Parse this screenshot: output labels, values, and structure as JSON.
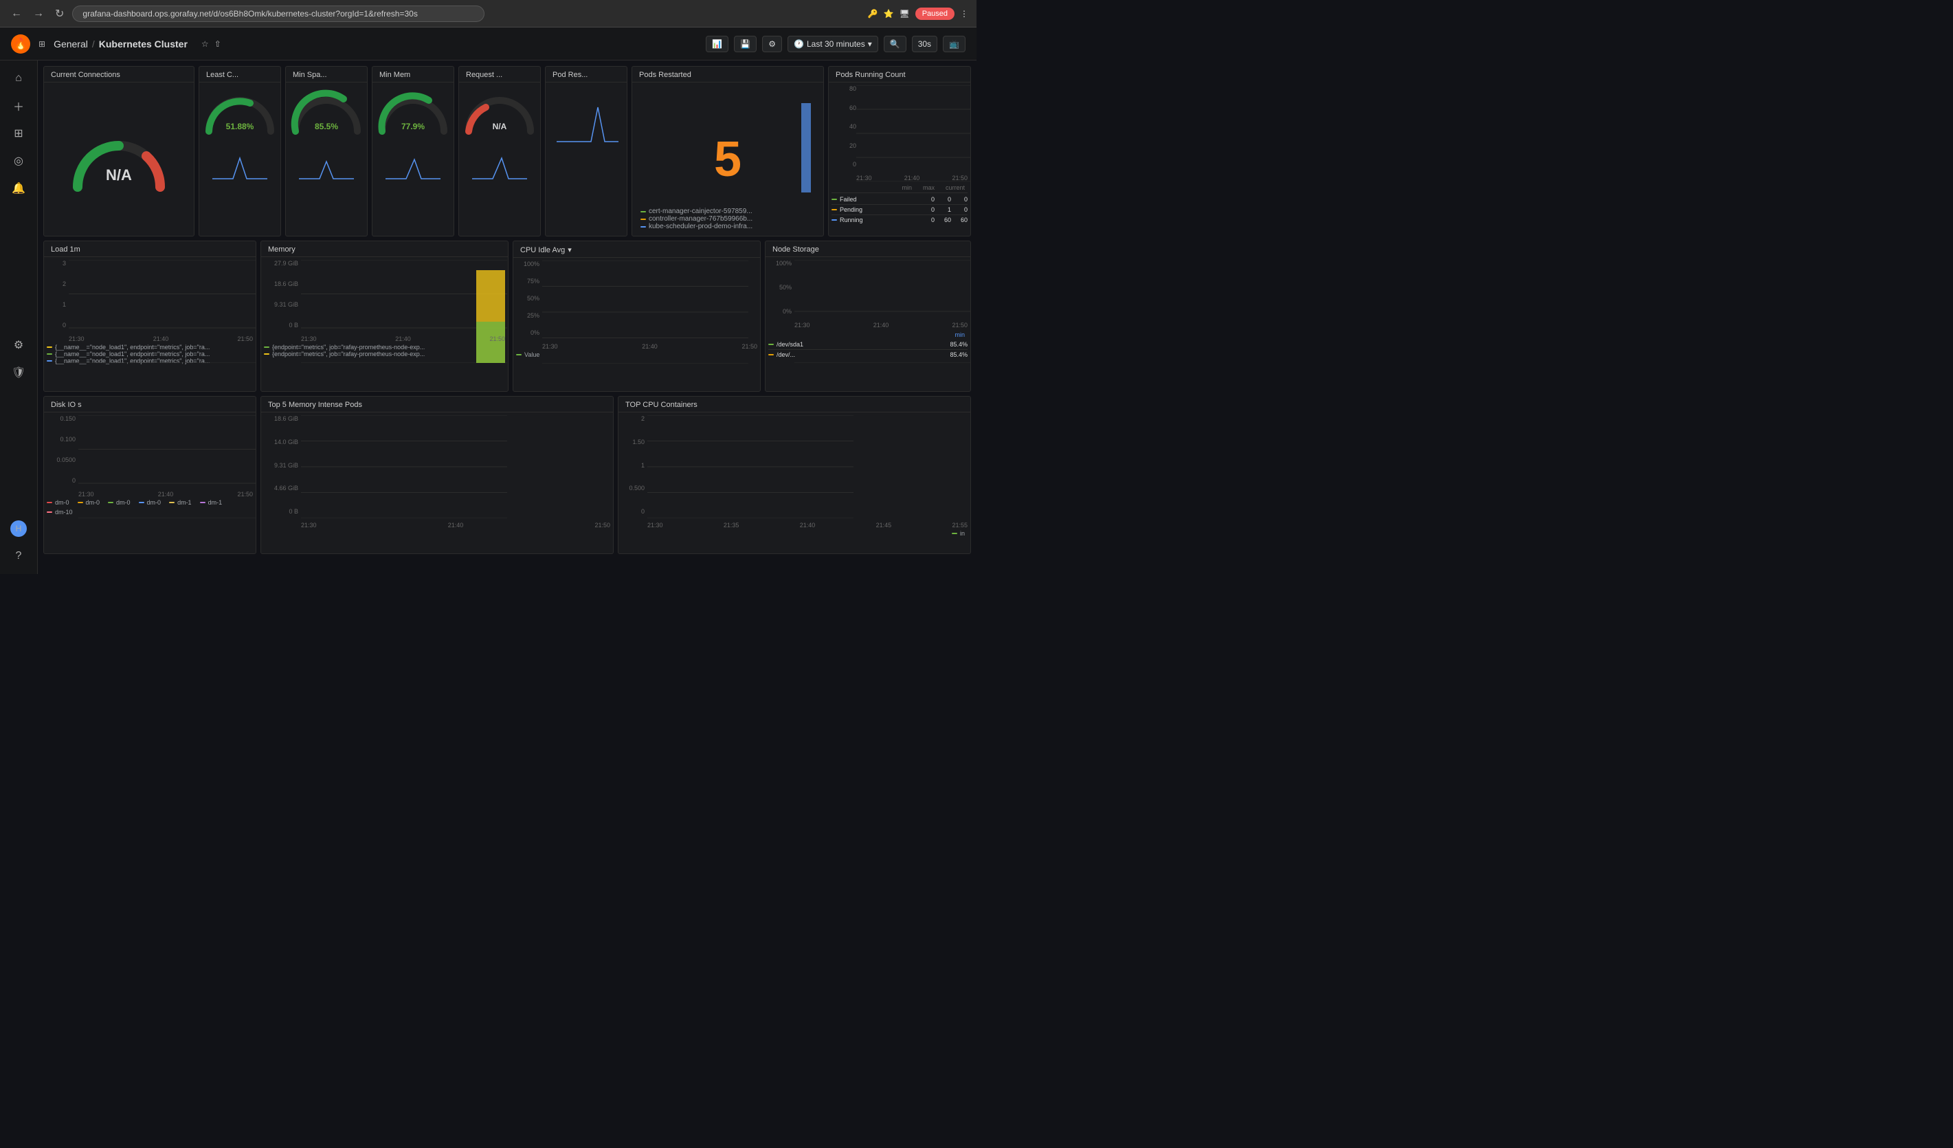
{
  "browser": {
    "url": "grafana-dashboard.ops.gorafay.net/d/os6Bh8Omk/kubernetes-cluster?orgId=1&refresh=30s",
    "paused_label": "Paused"
  },
  "header": {
    "app_name": "General",
    "separator": "/",
    "dashboard_name": "Kubernetes Cluster",
    "time_range": "Last 30 minutes",
    "refresh": "30s"
  },
  "sidebar": {
    "items": [
      {
        "icon": "⌂",
        "name": "home"
      },
      {
        "icon": "+",
        "name": "add"
      },
      {
        "icon": "⊞",
        "name": "dashboards"
      },
      {
        "icon": "◎",
        "name": "explore"
      },
      {
        "icon": "🔔",
        "name": "alerting"
      },
      {
        "icon": "⚙",
        "name": "settings"
      },
      {
        "icon": "🛡",
        "name": "shield"
      }
    ],
    "bottom_items": [
      {
        "icon": "👤",
        "name": "user"
      },
      {
        "icon": "?",
        "name": "help"
      }
    ]
  },
  "panels": {
    "current_connections": {
      "title": "Current Connections",
      "value": "N/A",
      "gauge_type": "half"
    },
    "least_c": {
      "title": "Least C...",
      "value": "51.88%",
      "gauge_type": "half"
    },
    "min_spa": {
      "title": "Min Spa...",
      "value": "85.5%",
      "gauge_type": "half"
    },
    "min_mem": {
      "title": "Min Mem",
      "value": "77.9%",
      "gauge_type": "half"
    },
    "request": {
      "title": "Request ...",
      "value": "N/A",
      "gauge_type": "half_orange"
    },
    "pod_res": {
      "title": "Pod Res...",
      "value": "",
      "has_spark": true
    },
    "pods_restarted": {
      "title": "Pods Restarted",
      "value": "5",
      "legend": [
        {
          "color": "#6db33f",
          "label": "cert-manager-cainjector-597859..."
        },
        {
          "color": "#e5a005",
          "label": "controller-manager-767b59966b..."
        },
        {
          "color": "#5794f2",
          "label": "kube-scheduler-prod-demo-infra..."
        }
      ]
    },
    "pods_running_count": {
      "title": "Pods Running Count",
      "y_labels": [
        "80",
        "60",
        "40",
        "20",
        "0"
      ],
      "x_labels": [
        "21:30",
        "21:40",
        "21:50"
      ],
      "legend_headers": [
        "min",
        "max",
        "current"
      ],
      "legend_rows": [
        {
          "color": "#6db33f",
          "name": "Failed",
          "min": "0",
          "max": "0",
          "current": "0"
        },
        {
          "color": "#e5a005",
          "name": "Pending",
          "min": "0",
          "max": "1",
          "current": "0"
        },
        {
          "color": "#5794f2",
          "name": "Running",
          "min": "0",
          "max": "60",
          "current": "60"
        }
      ]
    },
    "load_1m": {
      "title": "Load 1m",
      "y_labels": [
        "3",
        "2",
        "1",
        "0"
      ],
      "x_labels": [
        "21:30",
        "21:40",
        "21:50"
      ],
      "legend": [
        {
          "color": "#f0c418",
          "label": "{__name__=\"node_load1\", endpoint=\"metrics\", job=\"ra..."
        },
        {
          "color": "#6db33f",
          "label": "{__name__=\"node_load1\", endpoint=\"metrics\", job=\"ra..."
        },
        {
          "color": "#5794f2",
          "label": "{__name__=\"node_load1\", endpoint=\"metrics\", job=\"ra..."
        }
      ]
    },
    "memory": {
      "title": "Memory",
      "y_labels": [
        "27.9 GiB",
        "18.6 GiB",
        "9.31 GiB",
        "0 B"
      ],
      "x_labels": [
        "21:30",
        "21:40",
        "21:50"
      ],
      "legend": [
        {
          "color": "#6db33f",
          "label": "{endpoint=\"metrics\", job=\"rafay-prometheus-node-exp..."
        },
        {
          "color": "#f0c418",
          "label": "{endpoint=\"metrics\", job=\"rafay-prometheus-node-exp..."
        }
      ]
    },
    "cpu_idle_avg": {
      "title": "CPU Idle Avg",
      "y_labels": [
        "100%",
        "75%",
        "50%",
        "25%",
        "0%"
      ],
      "x_labels": [
        "21:30",
        "21:40",
        "21:50"
      ],
      "legend": [
        {
          "color": "#6db33f",
          "label": "Value"
        }
      ]
    },
    "node_storage": {
      "title": "Node Storage",
      "y_labels": [
        "100%",
        "50%",
        "0%"
      ],
      "x_labels": [
        "21:30",
        "21:40",
        "21:50"
      ],
      "legend_header": "min",
      "storage_rows": [
        {
          "color": "#6db33f",
          "name": "/dev/sda1",
          "value": "85.4%"
        },
        {
          "color": "#e5a005",
          "name": "/dev/...",
          "value": "85.4%"
        }
      ]
    },
    "disk_io": {
      "title": "Disk IO s",
      "y_labels": [
        "0.150",
        "0.100",
        "0.0500",
        "0"
      ],
      "x_labels": [
        "21:30",
        "21:40",
        "21:50"
      ],
      "legend": [
        {
          "color": "#e0494a",
          "label": "dm-0"
        },
        {
          "color": "#e5a005",
          "label": "dm-0"
        },
        {
          "color": "#6db33f",
          "label": "dm-0"
        },
        {
          "color": "#5794f2",
          "label": "dm-0"
        },
        {
          "color": "#e0c050",
          "label": "dm-1"
        },
        {
          "color": "#b877d9",
          "label": "dm-1"
        },
        {
          "color": "#ff7383",
          "label": "dm-10"
        }
      ]
    },
    "top5_memory_pods": {
      "title": "Top 5 Memory Intense Pods",
      "y_labels": [
        "18.6 GiB",
        "14.0 GiB",
        "9.31 GiB",
        "4.66 GiB",
        "0 B"
      ],
      "x_labels": [
        "21:30",
        "21:40",
        "21:50"
      ]
    },
    "top_cpu_containers": {
      "title": "TOP CPU Containers",
      "y_labels": [
        "2",
        "1.50",
        "1",
        "0.500",
        "0"
      ],
      "x_labels": [
        "21:30",
        "21:35",
        "21:40",
        "21:45",
        "21:55"
      ],
      "legend": [
        {
          "color": "#6db33f",
          "label": "in"
        }
      ]
    }
  }
}
